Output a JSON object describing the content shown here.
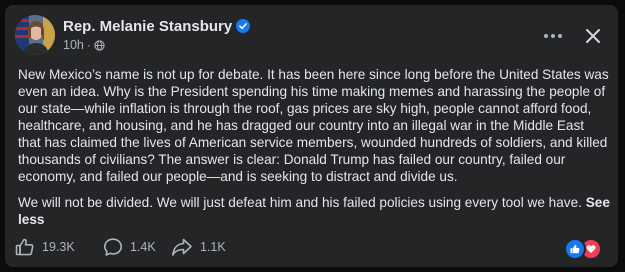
{
  "post": {
    "author": "Rep. Melanie Stansbury",
    "timestamp": "10h",
    "meta_separator": "·",
    "paragraphs": [
      "New Mexico’s name is not up for debate. It has been here since long before the United States was even an idea. Why is the President spending his time making memes and harassing the people of our state—while inflation is through the roof, gas prices are sky high, people cannot afford food, healthcare, and housing, and he has dragged our country into an illegal war in the Middle East that has claimed the lives of American service members, wounded hundreds of soldiers, and killed thousands of civilians? The answer is clear: Donald Trump has failed our country, failed our economy, and failed our people—and is seeking to distract and divide us.",
      "We will not be divided. We will just defeat him and his failed policies using every tool we have."
    ],
    "see_less": "See less"
  },
  "footer": {
    "likes": "19.3K",
    "comments": "1.4K",
    "shares": "1.1K"
  },
  "icons": {
    "verified": "verified-badge-icon",
    "audience": "globe-icon",
    "more": "more-horizontal-icon",
    "close": "close-icon",
    "like": "thumbs-up-icon",
    "comment": "comment-bubble-icon",
    "share": "share-arrow-icon",
    "reaction_like": "like-reaction-icon",
    "reaction_love": "love-reaction-icon"
  },
  "colors": {
    "card_background": "#242526",
    "page_background": "#0b0b0c",
    "text_primary": "#e4e6eb",
    "text_secondary": "#b0b3b8",
    "accent_blue": "#1877f2",
    "love_red": "#f33e58"
  }
}
